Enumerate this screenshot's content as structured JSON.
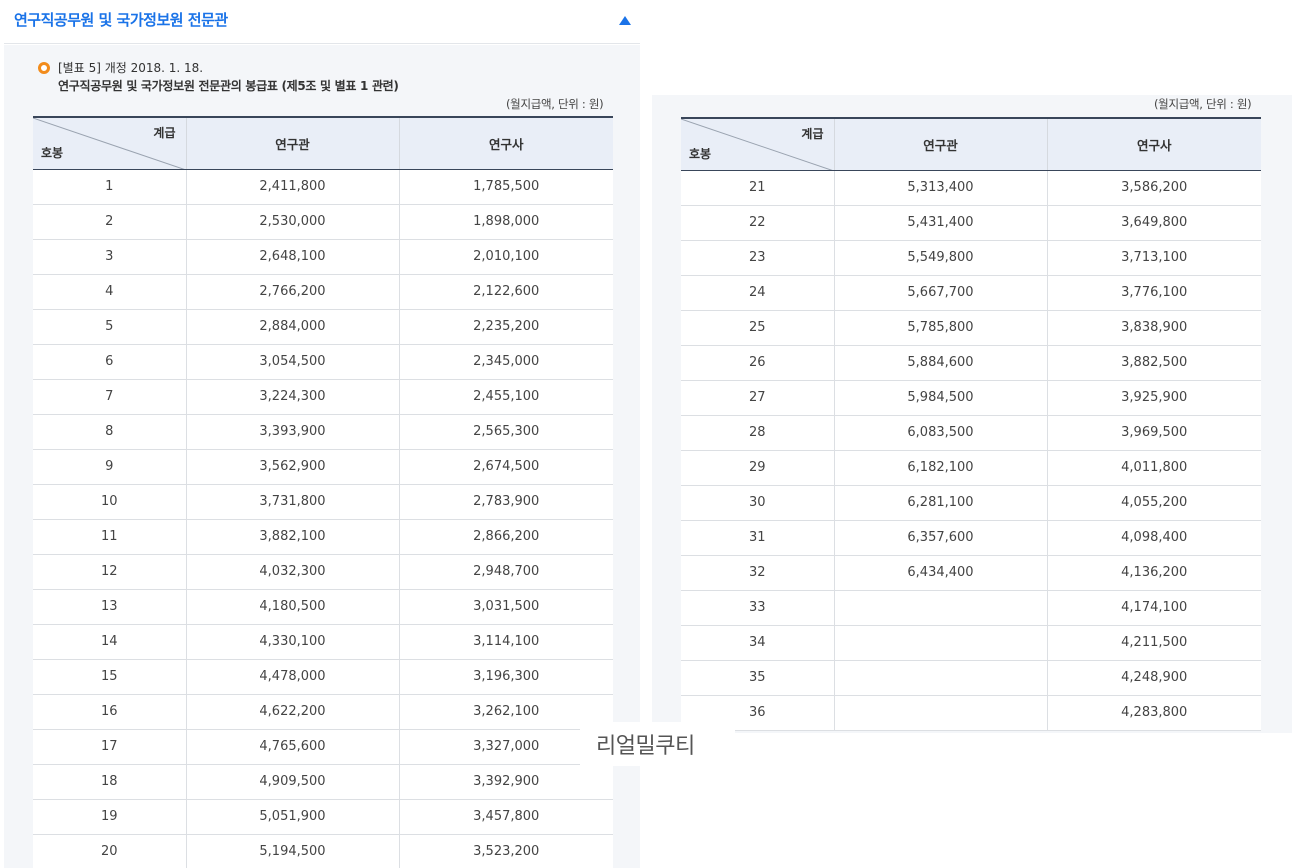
{
  "header": {
    "title": "연구직공무원 및 국가정보원 전문관"
  },
  "note": {
    "line1": "[별표 5] 개정 2018. 1. 18.",
    "line2": "연구직공무원 및 국가정보원 전문관의 봉급표 (제5조 및 별표 1 관련)"
  },
  "unit_label": "(월지급액, 단위 : 원)",
  "table_header": {
    "grade": "계급",
    "step": "호봉",
    "col1": "연구관",
    "col2": "연구사"
  },
  "left_rows": [
    [
      "1",
      "2,411,800",
      "1,785,500"
    ],
    [
      "2",
      "2,530,000",
      "1,898,000"
    ],
    [
      "3",
      "2,648,100",
      "2,010,100"
    ],
    [
      "4",
      "2,766,200",
      "2,122,600"
    ],
    [
      "5",
      "2,884,000",
      "2,235,200"
    ],
    [
      "6",
      "3,054,500",
      "2,345,000"
    ],
    [
      "7",
      "3,224,300",
      "2,455,100"
    ],
    [
      "8",
      "3,393,900",
      "2,565,300"
    ],
    [
      "9",
      "3,562,900",
      "2,674,500"
    ],
    [
      "10",
      "3,731,800",
      "2,783,900"
    ],
    [
      "11",
      "3,882,100",
      "2,866,200"
    ],
    [
      "12",
      "4,032,300",
      "2,948,700"
    ],
    [
      "13",
      "4,180,500",
      "3,031,500"
    ],
    [
      "14",
      "4,330,100",
      "3,114,100"
    ],
    [
      "15",
      "4,478,000",
      "3,196,300"
    ],
    [
      "16",
      "4,622,200",
      "3,262,100"
    ],
    [
      "17",
      "4,765,600",
      "3,327,000"
    ],
    [
      "18",
      "4,909,500",
      "3,392,900"
    ],
    [
      "19",
      "5,051,900",
      "3,457,800"
    ],
    [
      "20",
      "5,194,500",
      "3,523,200"
    ]
  ],
  "right_rows": [
    [
      "21",
      "5,313,400",
      "3,586,200"
    ],
    [
      "22",
      "5,431,400",
      "3,649,800"
    ],
    [
      "23",
      "5,549,800",
      "3,713,100"
    ],
    [
      "24",
      "5,667,700",
      "3,776,100"
    ],
    [
      "25",
      "5,785,800",
      "3,838,900"
    ],
    [
      "26",
      "5,884,600",
      "3,882,500"
    ],
    [
      "27",
      "5,984,500",
      "3,925,900"
    ],
    [
      "28",
      "6,083,500",
      "3,969,500"
    ],
    [
      "29",
      "6,182,100",
      "4,011,800"
    ],
    [
      "30",
      "6,281,100",
      "4,055,200"
    ],
    [
      "31",
      "6,357,600",
      "4,098,400"
    ],
    [
      "32",
      "6,434,400",
      "4,136,200"
    ],
    [
      "33",
      "",
      "4,174,100"
    ],
    [
      "34",
      "",
      "4,211,500"
    ],
    [
      "35",
      "",
      "4,248,900"
    ],
    [
      "36",
      "",
      "4,283,800"
    ]
  ],
  "watermark": "리얼밀쿠티",
  "colors": {
    "accent": "#1a73e8",
    "bullet": "#f28c1c",
    "header_bg": "#e9eef7"
  },
  "icons": {
    "collapse": "triangle-up-icon",
    "bullet": "circle-bullet-icon"
  }
}
